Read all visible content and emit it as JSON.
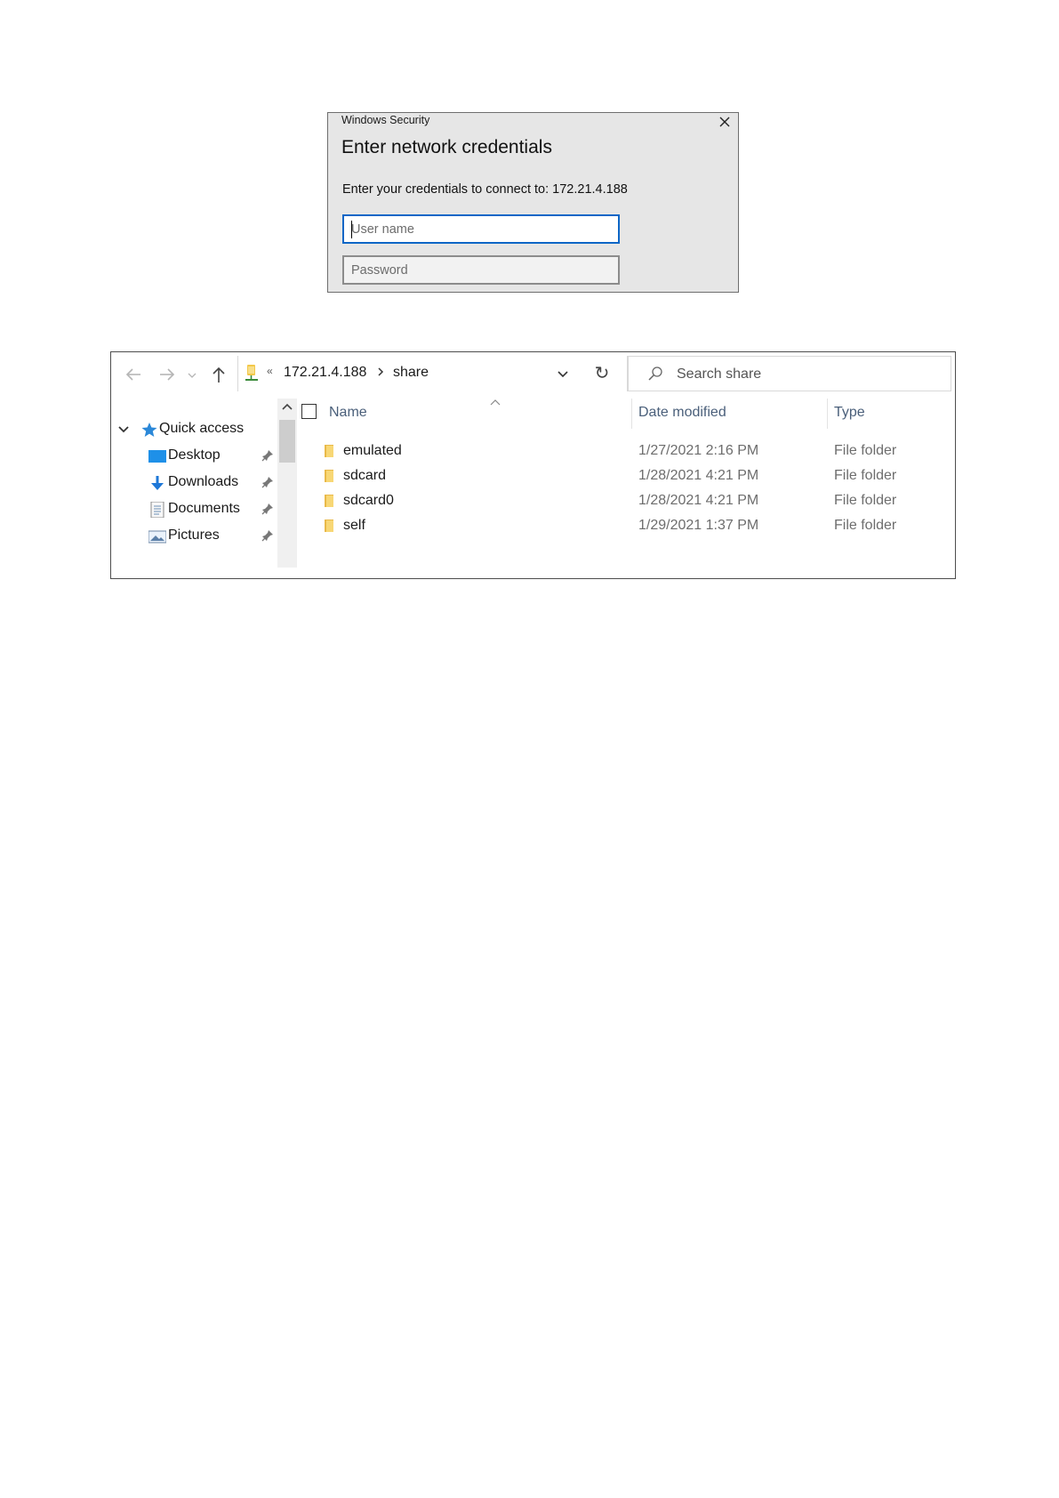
{
  "dialog": {
    "app_name": "Windows Security",
    "title": "Enter network credentials",
    "message": "Enter your credentials to connect to: 172.21.4.188",
    "username_placeholder": "User name",
    "password_placeholder": "Password"
  },
  "explorer": {
    "breadcrumb": [
      "172.21.4.188",
      "share"
    ],
    "search_placeholder": "Search share",
    "nav": [
      {
        "label": "Quick access",
        "icon": "star-icon"
      },
      {
        "label": "Desktop",
        "icon": "desktop-icon",
        "pinned": true
      },
      {
        "label": "Downloads",
        "icon": "download-arrow-icon",
        "pinned": true
      },
      {
        "label": "Documents",
        "icon": "document-icon",
        "pinned": true
      },
      {
        "label": "Pictures",
        "icon": "pictures-icon",
        "pinned": true
      }
    ],
    "columns": {
      "name": "Name",
      "date": "Date modified",
      "type": "Type"
    },
    "files": [
      {
        "name": "emulated",
        "date": "1/27/2021 2:16 PM",
        "type": "File folder"
      },
      {
        "name": "sdcard",
        "date": "1/28/2021 4:21 PM",
        "type": "File folder"
      },
      {
        "name": "sdcard0",
        "date": "1/28/2021 4:21 PM",
        "type": "File folder"
      },
      {
        "name": "self",
        "date": "1/29/2021 1:37 PM",
        "type": "File folder"
      }
    ],
    "colors": {
      "accent": "#0a66c6",
      "folder": "#f8d775",
      "folder_dark": "#e9b949",
      "header_text": "#4a5f7a"
    }
  }
}
